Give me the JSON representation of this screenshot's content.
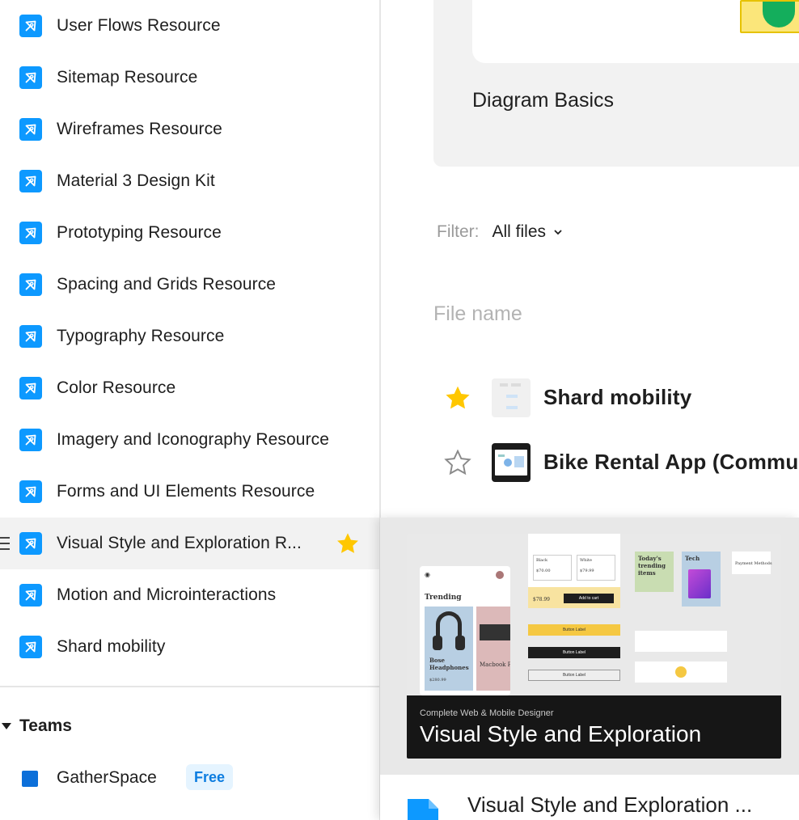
{
  "sidebar": {
    "items": [
      {
        "label": "User Flows Resource"
      },
      {
        "label": "Sitemap Resource"
      },
      {
        "label": "Wireframes Resource"
      },
      {
        "label": "Material 3 Design Kit"
      },
      {
        "label": "Prototyping Resource"
      },
      {
        "label": "Spacing and Grids Resource"
      },
      {
        "label": "Typography Resource"
      },
      {
        "label": "Color Resource"
      },
      {
        "label": "Imagery and Iconography Resource"
      },
      {
        "label": "Forms and UI Elements Resource"
      },
      {
        "label": "Visual Style and Exploration R..."
      },
      {
        "label": "Motion and Microinteractions"
      },
      {
        "label": "Shard mobility"
      }
    ],
    "teams_label": "Teams",
    "team": {
      "label": "GatherSpace",
      "badge": "Free"
    }
  },
  "main": {
    "card_title": "Diagram Basics",
    "filter_label": "Filter:",
    "filter_value": "All files",
    "column_header": "File name",
    "files": [
      {
        "title": "Shard mobility",
        "starred": true
      },
      {
        "title": "Bike Rental App (Commun",
        "starred": false
      }
    ]
  },
  "preview": {
    "subtitle": "Complete Web & Mobile Designer",
    "title": "Visual Style and Exploration",
    "file_title": "Visual Style and Exploration ...",
    "mock": {
      "trending": "Trending",
      "product1": "Bose Headphones",
      "price1": "$280.99",
      "product2": "Macbook Pro",
      "todays_trending": "Today's trending items",
      "tech": "Tech",
      "payment": "Payment Methods",
      "add_to_cart": "Add to cart",
      "button_label": "Button Label",
      "price_big": "$78.99",
      "opt_black": "Black",
      "opt_white": "White",
      "opt_price1": "$70.00",
      "opt_price2": "$79.99"
    }
  },
  "colors": {
    "accent": "#0d99ff",
    "star": "#ffc700",
    "badge_bg": "#e5f4ff",
    "badge_text": "#0d7de0"
  }
}
